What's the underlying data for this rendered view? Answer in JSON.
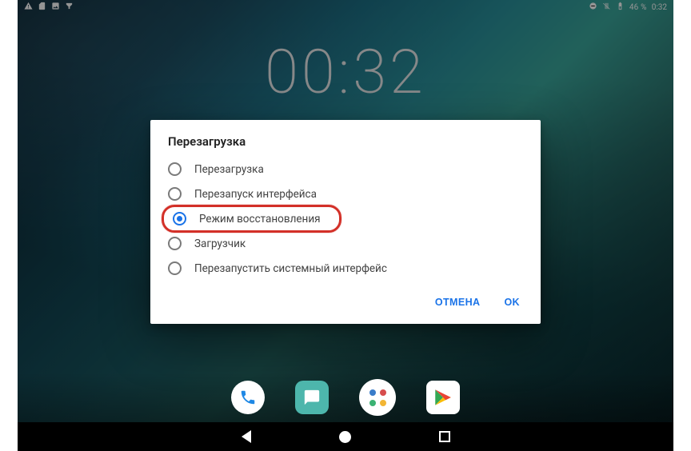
{
  "status": {
    "battery_pct": "46 %",
    "time": "0:32"
  },
  "clock": {
    "time": "00:32"
  },
  "dialog": {
    "title": "Перезагрузка",
    "options": [
      {
        "label": "Перезагрузка",
        "selected": false
      },
      {
        "label": "Перезапуск интерфейса",
        "selected": false
      },
      {
        "label": "Режим восстановления",
        "selected": true,
        "highlighted": true
      },
      {
        "label": "Загрузчик",
        "selected": false
      },
      {
        "label": "Перезапустить системный интерфейс",
        "selected": false
      }
    ],
    "cancel": "ОТМЕНА",
    "ok": "OK"
  },
  "dock": {
    "apps": [
      "phone",
      "messages",
      "app-drawer",
      "play-store"
    ]
  }
}
